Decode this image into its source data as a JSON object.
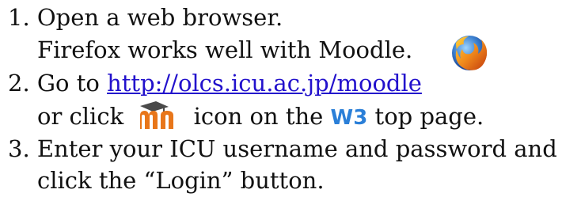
{
  "steps": [
    {
      "number": "1.",
      "line1": "Open a web browser.",
      "line2": "Firefox works well with Moodle."
    },
    {
      "number": "2.",
      "line1_prefix": "Go to ",
      "link": "http://olcs.icu.ac.jp/moodle",
      "line2_prefix": "or click",
      "line2_suffix": "icon on the",
      "w3": "W3",
      "line2_end": "top page."
    },
    {
      "number": "3.",
      "line1": "Enter your ICU username and password and",
      "line2": "click the “Login” button."
    }
  ],
  "icons": {
    "firefox": "firefox-logo-icon",
    "moodle": "moodle-logo-icon"
  },
  "colors": {
    "link": "#2211cc",
    "w3": "#2a7fd8",
    "text": "#111111"
  }
}
